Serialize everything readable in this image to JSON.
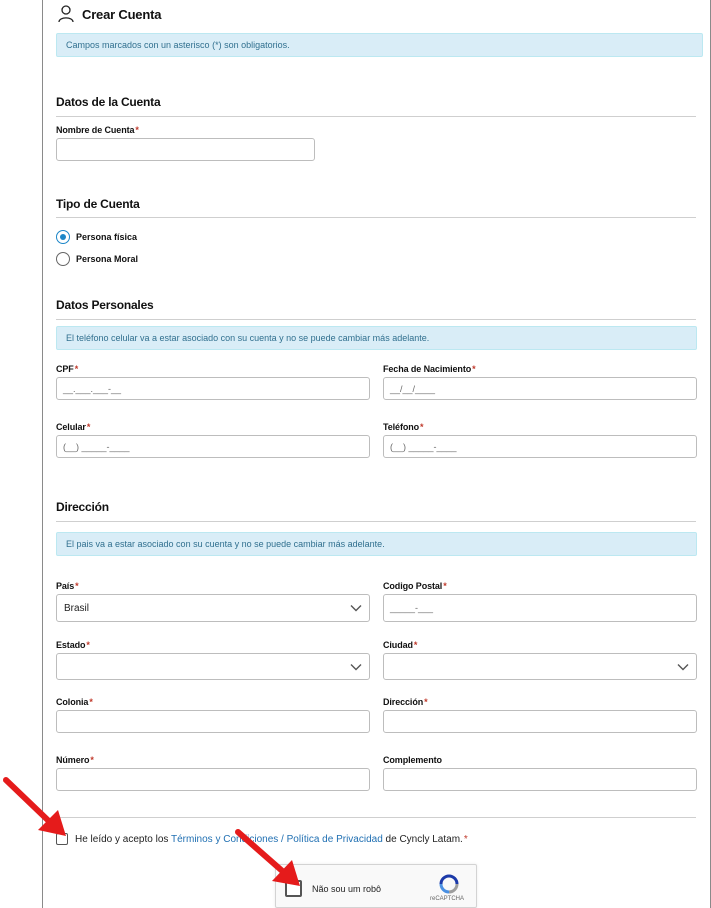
{
  "header": {
    "title": "Crear Cuenta",
    "icon": "user-icon"
  },
  "alerts": {
    "required": "Campos marcados con un asterisco (*) son obligatorios.",
    "phone": "El teléfono celular va a estar asociado con su cuenta y no se puede cambiar más adelante.",
    "country": "El pais va a estar asociado con su cuenta y no se puede cambiar más adelante."
  },
  "account": {
    "section": "Datos de la Cuenta",
    "name_label": "Nombre de Cuenta",
    "name_value": ""
  },
  "account_type": {
    "section": "Tipo de Cuenta",
    "options": [
      {
        "label": "Persona física",
        "checked": true
      },
      {
        "label": "Persona Moral",
        "checked": false
      }
    ]
  },
  "personal": {
    "section": "Datos Personales",
    "cpf_label": "CPF",
    "cpf_mask": "__.___.___-__",
    "birth_label": "Fecha de Nacimiento",
    "birth_mask": "__/__/____",
    "mobile_label": "Celular",
    "mobile_mask": "(__) _____-____",
    "phone_label": "Teléfono",
    "phone_mask": "(__) _____-____"
  },
  "address": {
    "section": "Dirección",
    "country_label": "País",
    "country_value": "Brasil",
    "postal_label": "Codigo Postal",
    "postal_mask": "_____-___",
    "state_label": "Estado",
    "state_value": "",
    "city_label": "Ciudad",
    "city_value": "",
    "colony_label": "Colonia",
    "street_label": "Dirección",
    "number_label": "Número",
    "complement_label": "Complemento"
  },
  "required_mark": "*",
  "terms": {
    "prefix": "He leído y acepto los ",
    "link": "Términos y Condiciones / Política de Privacidad",
    "suffix": " de Cyncly Latam.",
    "required": "*"
  },
  "captcha": {
    "label": "Não sou um robô",
    "brand": "reCAPTCHA"
  },
  "colors": {
    "accent": "#1c86c8",
    "alert_bg": "#d9edf7",
    "alert_text": "#31708f",
    "required": "#c0392b",
    "arrow": "#e51b1b"
  }
}
